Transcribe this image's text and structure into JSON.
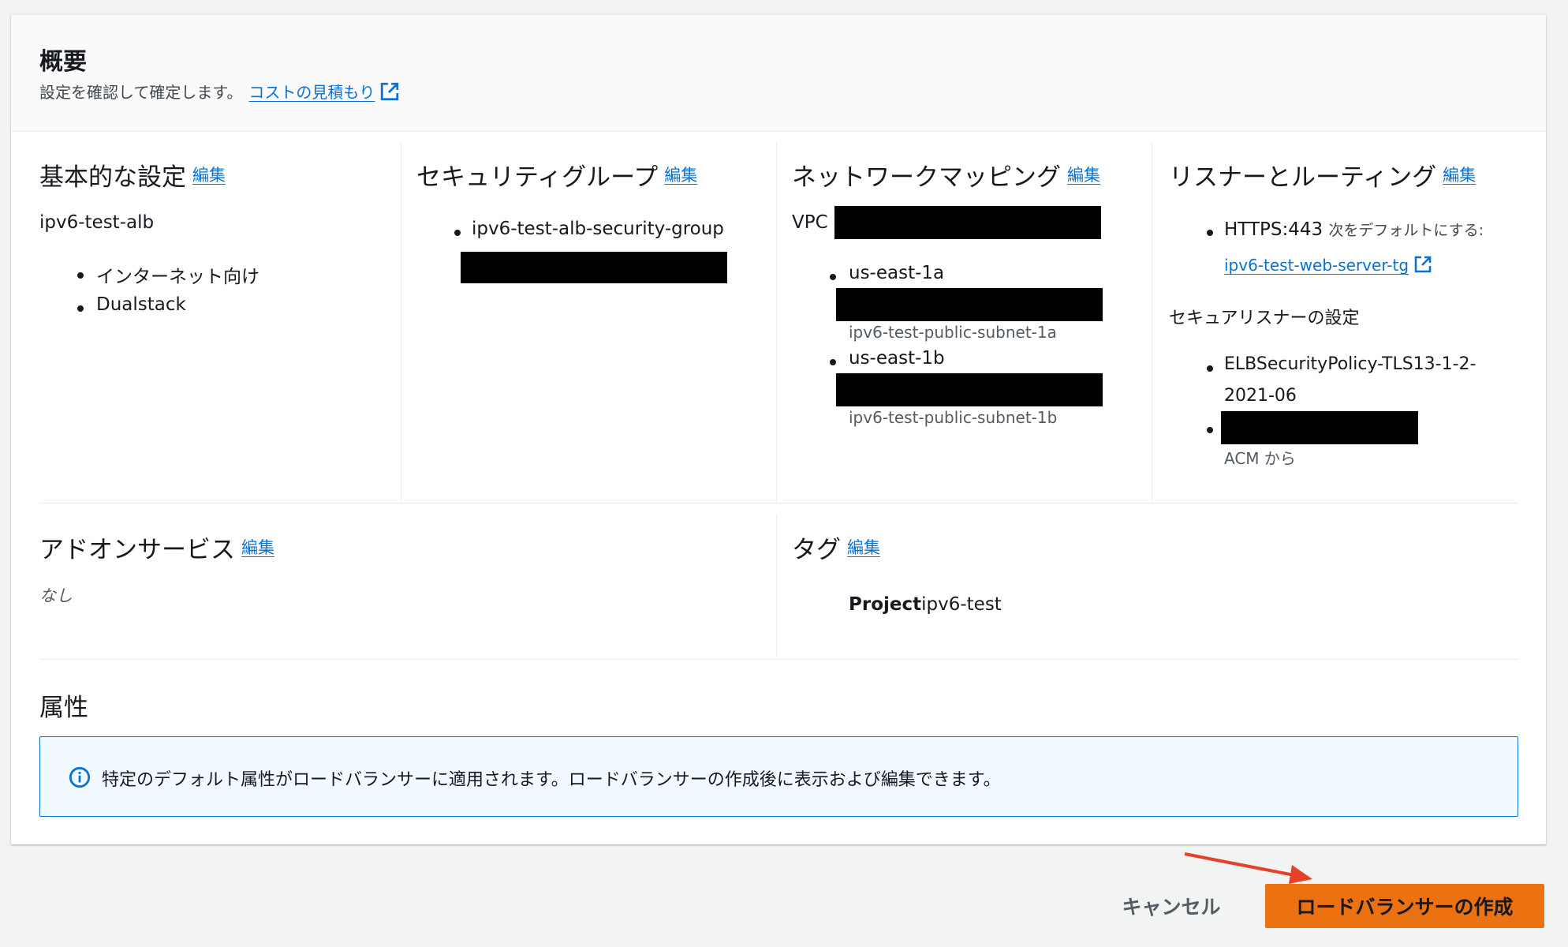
{
  "summary": {
    "title": "概要",
    "subtitle": "設定を確認して確定します。",
    "cost_link": "コストの見積もり"
  },
  "edit_label": "編集",
  "basic": {
    "title": "基本的な設定",
    "name": "ipv6-test-alb",
    "items": [
      "インターネット向け",
      "Dualstack"
    ]
  },
  "security_groups": {
    "title": "セキュリティグループ",
    "items": [
      "ipv6-test-alb-security-group"
    ]
  },
  "network": {
    "title": "ネットワークマッピング",
    "vpc_label": "VPC",
    "zones": [
      {
        "zone": "us-east-1a",
        "subnet_name": "ipv6-test-public-subnet-1a"
      },
      {
        "zone": "us-east-1b",
        "subnet_name": "ipv6-test-public-subnet-1b"
      }
    ]
  },
  "listeners": {
    "title": "リスナーとルーティング",
    "listener": "HTTPS:443",
    "forward_label": "次をデフォルトにする:",
    "target_group": "ipv6-test-web-server-tg",
    "secure_title": "セキュアリスナーの設定",
    "policy_line1": "ELBSecurityPolicy-TLS13-1-2-",
    "policy_line2": "2021-06",
    "cert_source": "ACM から"
  },
  "addons": {
    "title": "アドオンサービス",
    "value": "なし"
  },
  "tags": {
    "title": "タグ",
    "key": "Project",
    "value": "ipv6-test"
  },
  "attributes": {
    "title": "属性",
    "info": "特定のデフォルト属性がロードバランサーに適用されます。ロードバランサーの作成後に表示および編集できます。"
  },
  "actions": {
    "cancel": "キャンセル",
    "create": "ロードバランサーの作成"
  },
  "colors": {
    "link": "#0972d3",
    "primary_button": "#ec7211",
    "annotation_arrow": "#e8412a",
    "info_bg": "#f1faff"
  }
}
